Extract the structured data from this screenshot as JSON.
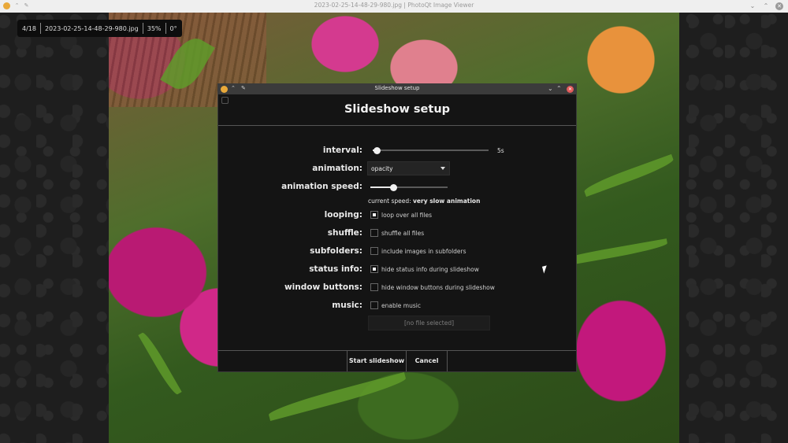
{
  "window": {
    "title": "2023-02-25-14-48-29-980.jpg | PhotoQt Image Viewer",
    "icons": [
      "photoqt-logo-icon",
      "pin-icon",
      "pushpin-icon"
    ],
    "controls": [
      "minimize-icon",
      "maximize-icon",
      "close-icon"
    ]
  },
  "status_bar": {
    "counter": "4/18",
    "filename": "2023-02-25-14-48-29-980.jpg",
    "zoom": "35%",
    "rotation": "0°"
  },
  "dialog": {
    "window_title": "Slideshow setup",
    "heading": "Slideshow setup",
    "interval": {
      "label": "interval:",
      "value_text": "5s",
      "value_fraction": 0.04
    },
    "animation": {
      "label": "animation:",
      "selected": "opacity"
    },
    "animation_speed": {
      "label": "animation speed:",
      "value_fraction": 0.3,
      "note_prefix": "current speed: ",
      "note_value": "very slow animation"
    },
    "looping": {
      "label": "looping:",
      "checkbox_label": "loop over all files",
      "checked": true
    },
    "shuffle": {
      "label": "shuffle:",
      "checkbox_label": "shuffle all files",
      "checked": false
    },
    "subfolders": {
      "label": "subfolders:",
      "checkbox_label": "include images in subfolders",
      "checked": false
    },
    "status_info": {
      "label": "status info:",
      "checkbox_label": "hide status info during slideshow",
      "checked": true
    },
    "window_buttons": {
      "label": "window buttons:",
      "checkbox_label": "hide window buttons during slideshow",
      "checked": false
    },
    "music": {
      "label": "music:",
      "checkbox_label": "enable music",
      "checked": false,
      "file_placeholder": "[no file selected]"
    },
    "buttons": {
      "start": "Start slideshow",
      "cancel": "Cancel"
    }
  }
}
